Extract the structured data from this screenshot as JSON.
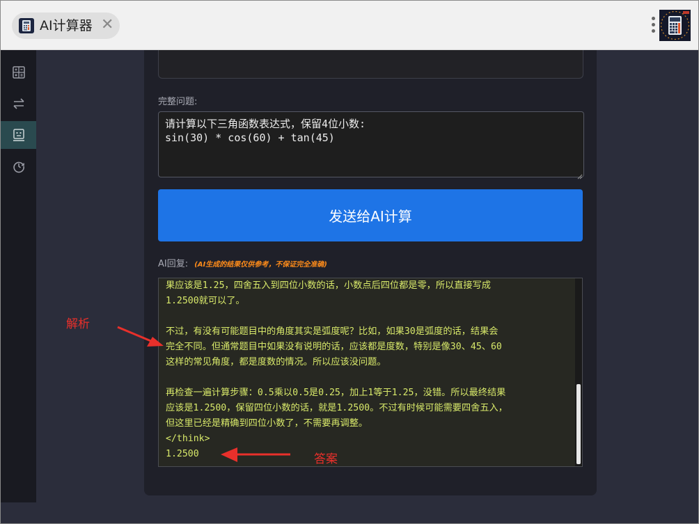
{
  "window": {
    "tab_title": "AI计算器",
    "tab_close": "✕"
  },
  "sidebar": {
    "items": [
      {
        "icon": "calculator-icon",
        "active": false
      },
      {
        "icon": "swap-arrows-icon",
        "active": false
      },
      {
        "icon": "robot-icon",
        "active": true
      },
      {
        "icon": "history-icon",
        "active": false
      }
    ]
  },
  "main": {
    "question_label": "完整问题:",
    "question_text": "请计算以下三角函数表达式，保留4位小数:\nsin(30) * cos(60) + tan(45)",
    "send_button": "发送给AI计算",
    "ai_label": "AI回复:",
    "ai_note": "(AI生成的结果仅供参考，不保证完全准确)",
    "answer_lines": [
      "果应该是1.25，四舍五入到四位小数的话，小数点后四位都是零，所以直接写成",
      "1.2500就可以了。",
      "",
      "不过，有没有可能题目中的角度其实是弧度呢？比如，如果30是弧度的话，结果会",
      "完全不同。但通常题目中如果没有说明的话，应该都是度数，特别是像30、45、60",
      "这样的常见角度，都是度数的情况。所以应该没问题。",
      "",
      "再检查一遍计算步骤：0.5乘以0.5是0.25，加上1等于1.25，没错。所以最终结果",
      "应该是1.2500，保留四位小数的话，就是1.2500。不过有时候可能需要四舍五入，",
      "但这里已经是精确到四位小数了，不需要再调整。",
      "</think>",
      "1.2500"
    ]
  },
  "annotations": {
    "analysis_label": "解析",
    "answer_label": "答案",
    "color": "#e8302b"
  },
  "colors": {
    "accent_button": "#1e74e6",
    "answer_text": "#d8e96a",
    "note_text": "#ff8c1a"
  }
}
